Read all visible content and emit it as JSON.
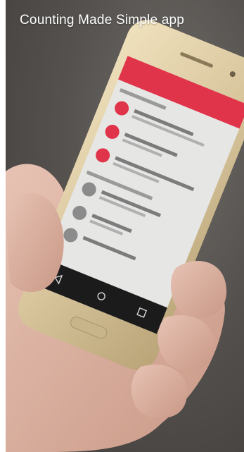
{
  "caption": "Counting Made Simple app",
  "colors": {
    "brand_red": "#e0344a",
    "screen_bg": "#e6e6e4",
    "phone_gold": "#d8c59c",
    "nav_bar": "#1b1b1b"
  },
  "icons": [
    "back-icon",
    "home-icon",
    "recents-icon",
    "assignment-icon"
  ]
}
